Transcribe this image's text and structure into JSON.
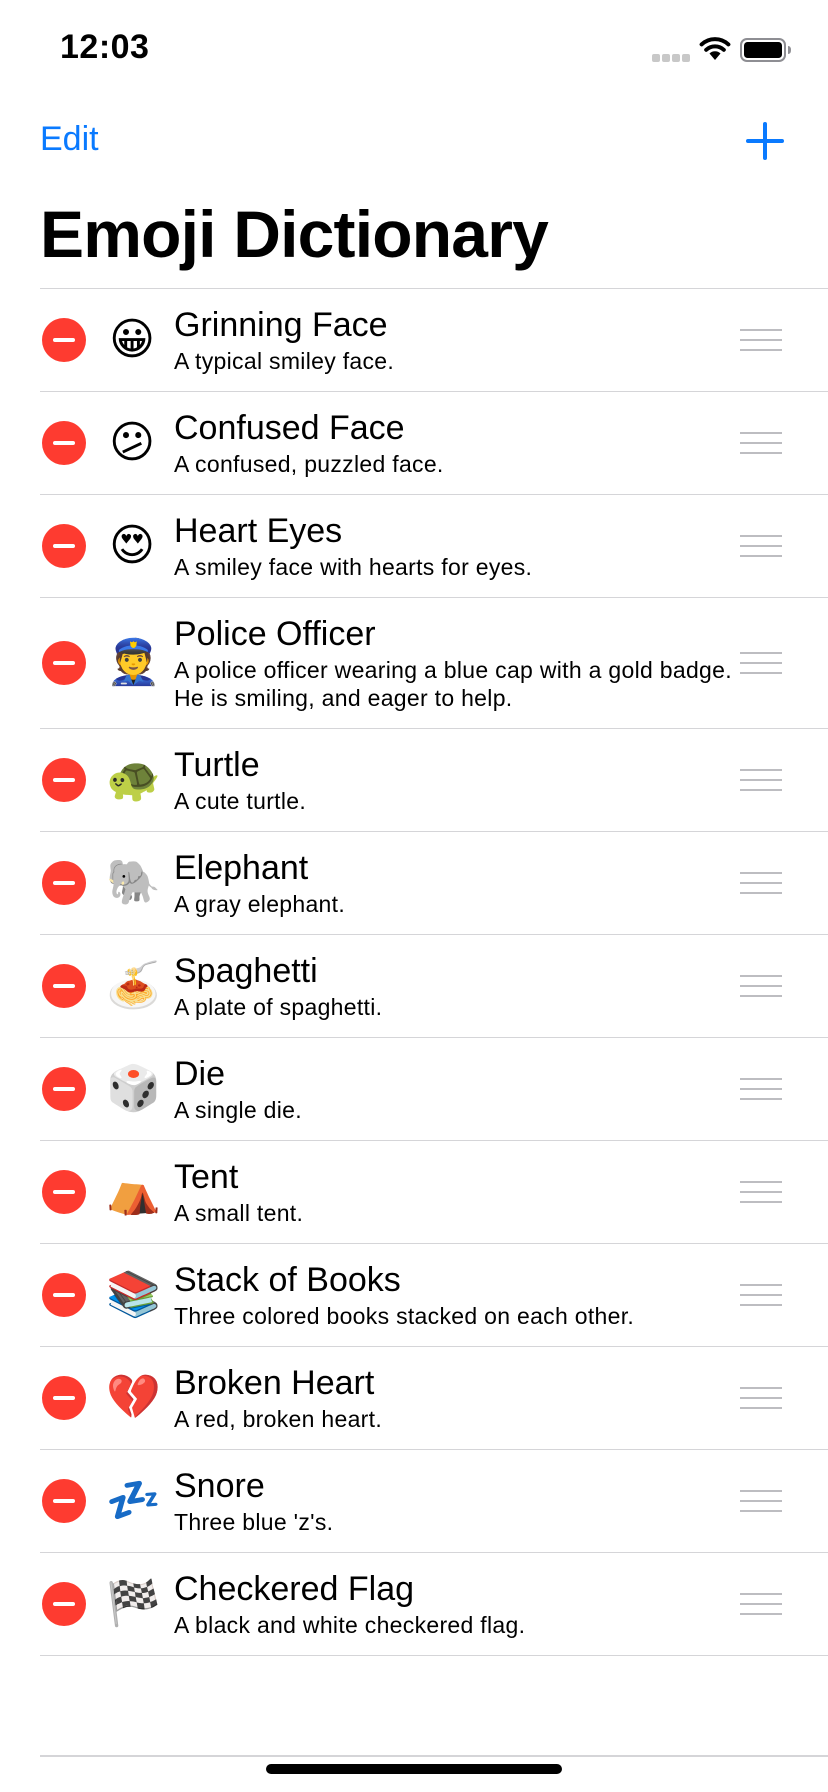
{
  "status_bar": {
    "time": "12:03"
  },
  "nav": {
    "edit_label": "Edit",
    "add_icon": "plus-icon",
    "title": "Emoji Dictionary"
  },
  "colors": {
    "tint": "#0a7aff",
    "delete": "#fe3b30",
    "separator": "#d5d5d8"
  },
  "items": [
    {
      "emoji": "😀",
      "name": "Grinning Face",
      "description": "A typical smiley face."
    },
    {
      "emoji": "😕",
      "name": "Confused Face",
      "description": "A confused, puzzled face."
    },
    {
      "emoji": "😍",
      "name": "Heart Eyes",
      "description": "A smiley face with hearts for eyes."
    },
    {
      "emoji": "👮",
      "name": "Police Officer",
      "description": "A police officer wearing a blue cap with a gold badge. He is smiling, and eager to help."
    },
    {
      "emoji": "🐢",
      "name": "Turtle",
      "description": "A cute turtle."
    },
    {
      "emoji": "🐘",
      "name": "Elephant",
      "description": "A gray elephant."
    },
    {
      "emoji": "🍝",
      "name": "Spaghetti",
      "description": "A plate of spaghetti."
    },
    {
      "emoji": "🎲",
      "name": "Die",
      "description": "A single die."
    },
    {
      "emoji": "⛺️",
      "name": "Tent",
      "description": "A small tent."
    },
    {
      "emoji": "📚",
      "name": "Stack of Books",
      "description": "Three colored books stacked on each other."
    },
    {
      "emoji": "💔",
      "name": "Broken Heart",
      "description": "A red, broken heart."
    },
    {
      "emoji": "💤",
      "name": "Snore",
      "description": "Three blue 'z's."
    },
    {
      "emoji": "🏁",
      "name": "Checkered Flag",
      "description": "A black and white checkered flag."
    }
  ]
}
